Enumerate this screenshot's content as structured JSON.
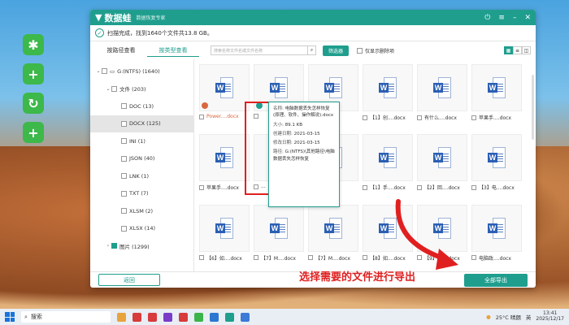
{
  "app": {
    "name": "数据蛙",
    "subtitle": "数据恢复专家",
    "status_text": "扫描完成，找到1640个文件共13.8 GB。"
  },
  "toolbar": {
    "tab_path": "按路径查看",
    "tab_type": "按类型查看",
    "search_placeholder": "搜索名称文件名或文件名称",
    "filter_label": "筛选器",
    "only_deleted_label": "仅显示删除项"
  },
  "tree": [
    {
      "label": "G:(NTFS) (1640)",
      "level": 0,
      "arrow": "v",
      "checked": false
    },
    {
      "label": "文件 (203)",
      "level": 1,
      "arrow": "v",
      "checked": false
    },
    {
      "label": "DOC (13)",
      "level": 2,
      "arrow": "",
      "checked": false
    },
    {
      "label": "DOCX (125)",
      "level": 2,
      "arrow": "",
      "checked": false,
      "selected": true
    },
    {
      "label": "INI (1)",
      "level": 2,
      "arrow": "",
      "checked": false
    },
    {
      "label": "JSON (40)",
      "level": 2,
      "arrow": "",
      "checked": false
    },
    {
      "label": "LNK (1)",
      "level": 2,
      "arrow": "",
      "checked": false
    },
    {
      "label": "TXT (7)",
      "level": 2,
      "arrow": "",
      "checked": false
    },
    {
      "label": "XLSM (2)",
      "level": 2,
      "arrow": "",
      "checked": false
    },
    {
      "label": "XLSX (14)",
      "level": 2,
      "arrow": "",
      "checked": false
    },
    {
      "label": "图片 (1299)",
      "level": 1,
      "arrow": ">",
      "checked": true
    }
  ],
  "files": [
    {
      "name": "Power....docx",
      "badge": "orange"
    },
    {
      "name": "",
      "badge": "teal"
    },
    {
      "name": "",
      "badge": ""
    },
    {
      "name": "【1】创....docx",
      "badge": ""
    },
    {
      "name": "有什么....docx",
      "badge": ""
    },
    {
      "name": "苹果手....docx",
      "badge": ""
    },
    {
      "name": "苹果手....docx",
      "badge": ""
    },
    {
      "name": "...",
      "badge": ""
    },
    {
      "name": "",
      "badge": ""
    },
    {
      "name": "【1】手....docx",
      "badge": ""
    },
    {
      "name": "【2】回....docx",
      "badge": ""
    },
    {
      "name": "【3】电....docx",
      "badge": ""
    },
    {
      "name": "【6】如....docx",
      "badge": ""
    },
    {
      "name": "【7】M....docx",
      "badge": ""
    },
    {
      "name": "【7】M....docx",
      "badge": ""
    },
    {
      "name": "【8】如....docx",
      "badge": ""
    },
    {
      "name": "【9】如....docx",
      "badge": ""
    },
    {
      "name": "电脑政....docx",
      "badge": ""
    }
  ],
  "tooltip": {
    "name_label": "名称:",
    "name_value": "电脑数据丢失怎样恢复(原理、软件、操作解说).docx",
    "size_label": "大小:",
    "size_value": "89.1 KB",
    "created_label": "创建日期:",
    "created_value": "2021-03-15",
    "modified_label": "修改日期:",
    "modified_value": "2021-03-15",
    "path_label": "路径:",
    "path_value": "G:(NTFS)\\其他路径\\电脑数据丢失怎样恢复"
  },
  "footer": {
    "back_label": "返回",
    "export_label": "全部导出"
  },
  "annotation": "选择需要的文件进行导出",
  "taskbar": {
    "search_label": "搜索",
    "weather": "25°C 晴朗",
    "lang": "英",
    "time": "13:41",
    "date": "2025/12/17"
  },
  "colors": {
    "accent": "#1f9e8e",
    "annotation": "#e02020",
    "desktop_icon": "#3db84a"
  }
}
